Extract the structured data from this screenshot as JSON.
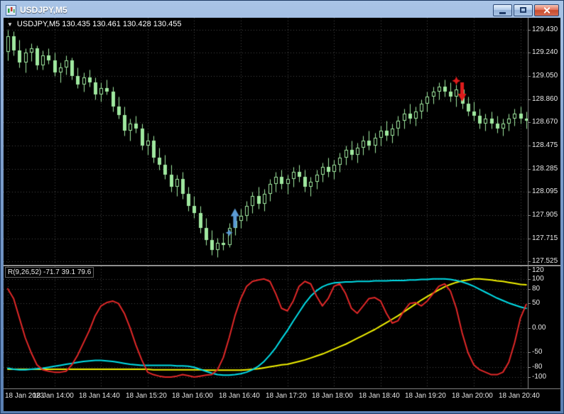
{
  "window": {
    "title": "USDJPY,M5"
  },
  "theme": {
    "background": "#000000",
    "grid": "#4a4a4a",
    "candle": "#9fe89f",
    "axis_text": "#e8e8e8",
    "axis_line": "#7f7f7f"
  },
  "chart": {
    "marker_icon": "▼",
    "ohlc_label": "USDJPY,M5 130.435 130.461 130.428 130.455"
  },
  "indicator": {
    "label": "R(9,26,52) -71.7 39.1 79.6"
  },
  "chart_data": {
    "type": "candlestick-with-oscillator",
    "symbol": "USDJPY",
    "timeframe": "M5",
    "layout": {
      "x0": 4,
      "dx": 8.2,
      "body_width": 5
    },
    "main": {
      "scale_max": 129.529,
      "scale_min": 127.496,
      "axis_labels": [
        "129.430",
        "129.240",
        "129.050",
        "128.860",
        "128.670",
        "128.475",
        "128.285",
        "128.095",
        "127.905",
        "127.715",
        "127.525"
      ],
      "candles": [
        [
          129.25,
          129.43,
          129.18,
          129.38
        ],
        [
          129.38,
          129.42,
          129.22,
          129.26
        ],
        [
          129.26,
          129.35,
          129.12,
          129.16
        ],
        [
          129.16,
          129.28,
          129.08,
          129.24
        ],
        [
          129.24,
          129.32,
          129.17,
          129.28
        ],
        [
          129.28,
          129.3,
          129.1,
          129.14
        ],
        [
          129.14,
          129.26,
          129.1,
          129.22
        ],
        [
          129.22,
          129.28,
          129.15,
          129.18
        ],
        [
          129.18,
          129.24,
          129.05,
          129.08
        ],
        [
          129.08,
          129.16,
          129.0,
          129.12
        ],
        [
          129.12,
          129.22,
          129.06,
          129.18
        ],
        [
          129.18,
          129.2,
          129.02,
          129.05
        ],
        [
          129.05,
          129.12,
          128.95,
          128.98
        ],
        [
          128.98,
          129.08,
          128.92,
          129.04
        ],
        [
          129.04,
          129.1,
          128.96,
          129.0
        ],
        [
          129.0,
          129.04,
          128.86,
          128.9
        ],
        [
          128.9,
          129.0,
          128.84,
          128.95
        ],
        [
          128.95,
          129.02,
          128.9,
          128.92
        ],
        [
          128.92,
          128.96,
          128.76,
          128.8
        ],
        [
          128.8,
          128.88,
          128.7,
          128.73
        ],
        [
          128.73,
          128.8,
          128.56,
          128.6
        ],
        [
          128.6,
          128.7,
          128.52,
          128.66
        ],
        [
          128.66,
          128.72,
          128.58,
          128.62
        ],
        [
          128.62,
          128.66,
          128.44,
          128.48
        ],
        [
          128.48,
          128.58,
          128.4,
          128.52
        ],
        [
          128.52,
          128.56,
          128.34,
          128.38
        ],
        [
          128.38,
          128.46,
          128.28,
          128.32
        ],
        [
          128.32,
          128.4,
          128.2,
          128.24
        ],
        [
          128.24,
          128.32,
          128.1,
          128.14
        ],
        [
          128.14,
          128.24,
          128.06,
          128.2
        ],
        [
          128.2,
          128.26,
          128.04,
          128.08
        ],
        [
          128.08,
          128.14,
          127.94,
          127.98
        ],
        [
          127.98,
          128.06,
          127.88,
          127.92
        ],
        [
          127.92,
          127.98,
          127.76,
          127.8
        ],
        [
          127.8,
          127.88,
          127.66,
          127.7
        ],
        [
          127.7,
          127.78,
          127.58,
          127.62
        ],
        [
          127.62,
          127.72,
          127.56,
          127.68
        ],
        [
          127.68,
          127.76,
          127.62,
          127.66
        ],
        [
          127.66,
          127.84,
          127.64,
          127.8
        ],
        [
          127.8,
          127.9,
          127.74,
          127.86
        ],
        [
          127.86,
          127.96,
          127.8,
          127.9
        ],
        [
          127.9,
          128.02,
          127.86,
          127.98
        ],
        [
          127.98,
          128.1,
          127.92,
          128.06
        ],
        [
          128.06,
          128.14,
          127.96,
          128.0
        ],
        [
          128.0,
          128.12,
          127.94,
          128.08
        ],
        [
          128.08,
          128.2,
          128.02,
          128.16
        ],
        [
          128.16,
          128.26,
          128.1,
          128.22
        ],
        [
          128.22,
          128.28,
          128.12,
          128.16
        ],
        [
          128.16,
          128.24,
          128.08,
          128.2
        ],
        [
          128.2,
          128.3,
          128.14,
          128.26
        ],
        [
          128.26,
          128.32,
          128.18,
          128.22
        ],
        [
          128.22,
          128.28,
          128.1,
          128.14
        ],
        [
          128.14,
          128.22,
          128.06,
          128.18
        ],
        [
          128.18,
          128.28,
          128.12,
          128.24
        ],
        [
          128.24,
          128.34,
          128.18,
          128.3
        ],
        [
          128.3,
          128.38,
          128.22,
          128.26
        ],
        [
          128.26,
          128.36,
          128.2,
          128.32
        ],
        [
          128.32,
          128.42,
          128.26,
          128.38
        ],
        [
          128.38,
          128.48,
          128.32,
          128.44
        ],
        [
          128.44,
          128.52,
          128.36,
          128.4
        ],
        [
          128.4,
          128.5,
          128.34,
          128.46
        ],
        [
          128.46,
          128.56,
          128.4,
          128.52
        ],
        [
          128.52,
          128.6,
          128.44,
          128.48
        ],
        [
          128.48,
          128.58,
          128.42,
          128.54
        ],
        [
          128.54,
          128.64,
          128.48,
          128.6
        ],
        [
          128.6,
          128.68,
          128.52,
          128.56
        ],
        [
          128.56,
          128.66,
          128.5,
          128.62
        ],
        [
          128.62,
          128.72,
          128.56,
          128.68
        ],
        [
          128.68,
          128.78,
          128.62,
          128.74
        ],
        [
          128.74,
          128.82,
          128.66,
          128.7
        ],
        [
          128.7,
          128.8,
          128.64,
          128.76
        ],
        [
          128.76,
          128.86,
          128.7,
          128.82
        ],
        [
          128.82,
          128.92,
          128.76,
          128.88
        ],
        [
          128.88,
          128.96,
          128.82,
          128.92
        ],
        [
          128.92,
          129.0,
          128.86,
          128.96
        ],
        [
          128.96,
          129.02,
          128.88,
          128.92
        ],
        [
          128.92,
          129.0,
          128.84,
          128.88
        ],
        [
          128.88,
          128.98,
          128.8,
          128.94
        ],
        [
          128.94,
          128.98,
          128.78,
          128.82
        ],
        [
          128.82,
          128.88,
          128.72,
          128.76
        ],
        [
          128.76,
          128.84,
          128.68,
          128.72
        ],
        [
          128.72,
          128.78,
          128.62,
          128.66
        ],
        [
          128.66,
          128.74,
          128.6,
          128.7
        ],
        [
          128.7,
          128.76,
          128.62,
          128.66
        ],
        [
          128.66,
          128.72,
          128.58,
          128.62
        ],
        [
          128.62,
          128.7,
          128.56,
          128.66
        ],
        [
          128.66,
          128.74,
          128.6,
          128.7
        ],
        [
          128.7,
          128.78,
          128.64,
          128.74
        ],
        [
          128.74,
          128.8,
          128.66,
          128.7
        ],
        [
          128.7,
          128.76,
          128.62,
          128.68
        ]
      ]
    },
    "oscillator": {
      "name": "R(9,26,52)",
      "current_values": [
        "-71.7",
        "39.1",
        "79.6"
      ],
      "scale_max": 125.8,
      "scale_min": -123.1,
      "axis_labels": [
        "120",
        "100",
        "80",
        "50",
        "0.00",
        "-50",
        "-80",
        "-100"
      ],
      "levels": [
        100,
        80,
        50,
        0,
        -50,
        -80,
        -100
      ],
      "series": [
        {
          "name": "fast-line",
          "color": "#e02828",
          "values": [
            80,
            60,
            20,
            -20,
            -50,
            -75,
            -85,
            -88,
            -90,
            -90,
            -88,
            -75,
            -55,
            -30,
            -5,
            25,
            45,
            52,
            55,
            50,
            30,
            0,
            -35,
            -65,
            -90,
            -95,
            -98,
            -100,
            -100,
            -98,
            -95,
            -97,
            -100,
            -98,
            -96,
            -95,
            -85,
            -60,
            -20,
            25,
            60,
            85,
            95,
            98,
            100,
            95,
            70,
            40,
            35,
            55,
            85,
            95,
            90,
            65,
            45,
            60,
            85,
            90,
            70,
            40,
            30,
            45,
            60,
            62,
            55,
            30,
            10,
            15,
            35,
            50,
            52,
            45,
            55,
            70,
            85,
            90,
            75,
            40,
            -10,
            -50,
            -75,
            -85,
            -90,
            -95,
            -95,
            -90,
            -70,
            -30,
            20,
            48
          ]
        },
        {
          "name": "medium-line",
          "color": "#00dce6",
          "values": [
            -82,
            -84,
            -85,
            -85,
            -84,
            -83,
            -82,
            -80,
            -78,
            -76,
            -74,
            -72,
            -70,
            -68,
            -67,
            -66,
            -66,
            -67,
            -68,
            -70,
            -72,
            -74,
            -75,
            -76,
            -76,
            -76,
            -76,
            -76,
            -76,
            -77,
            -77,
            -78,
            -80,
            -84,
            -88,
            -92,
            -95,
            -96,
            -96,
            -95,
            -93,
            -90,
            -85,
            -78,
            -68,
            -55,
            -40,
            -22,
            -5,
            14,
            32,
            50,
            65,
            76,
            84,
            89,
            92,
            93,
            94,
            94,
            95,
            95,
            95,
            96,
            96,
            96,
            97,
            97,
            97,
            98,
            98,
            99,
            99,
            100,
            100,
            100,
            99,
            97,
            94,
            90,
            85,
            79,
            73,
            67,
            61,
            56,
            51,
            47,
            43,
            40
          ]
        },
        {
          "name": "slow-line",
          "color": "#f0f000",
          "values": [
            -84,
            -84,
            -84,
            -84,
            -84,
            -84,
            -84,
            -84,
            -84,
            -84,
            -84,
            -84,
            -84,
            -84,
            -84,
            -84,
            -84,
            -84,
            -84,
            -84,
            -84,
            -84,
            -84,
            -84,
            -84,
            -85,
            -85,
            -85,
            -85,
            -85,
            -85,
            -85,
            -85,
            -85,
            -86,
            -86,
            -86,
            -86,
            -86,
            -86,
            -86,
            -85,
            -84,
            -83,
            -81,
            -79,
            -77,
            -75,
            -74,
            -71,
            -68,
            -65,
            -61,
            -57,
            -53,
            -48,
            -43,
            -38,
            -33,
            -27,
            -21,
            -15,
            -9,
            -3,
            4,
            11,
            18,
            25,
            33,
            41,
            49,
            57,
            64,
            71,
            78,
            84,
            89,
            93,
            96,
            98,
            100,
            100,
            99,
            98,
            96,
            95,
            93,
            91,
            89,
            88
          ]
        }
      ]
    },
    "time_axis": [
      {
        "text": "18 Jan 2023",
        "index": 0
      },
      {
        "text": "18 Jan 14:00",
        "index": 8
      },
      {
        "text": "18 Jan 14:40",
        "index": 16
      },
      {
        "text": "18 Jan 15:20",
        "index": 24
      },
      {
        "text": "18 Jan 16:00",
        "index": 32
      },
      {
        "text": "18 Jan 16:40",
        "index": 40
      },
      {
        "text": "18 Jan 17:20",
        "index": 48
      },
      {
        "text": "18 Jan 18:00",
        "index": 56
      },
      {
        "text": "18 Jan 18:40",
        "index": 64
      },
      {
        "text": "18 Jan 19:20",
        "index": 72
      },
      {
        "text": "18 Jan 20:00",
        "index": 80
      },
      {
        "text": "18 Jan 20:40",
        "index": 88
      }
    ],
    "signals": [
      {
        "name": "buy-arrow",
        "shape": "arrow-up",
        "index": 39,
        "price": 127.96,
        "color": "#5b9bd5",
        "size": 28
      },
      {
        "name": "buy-star",
        "shape": "star",
        "index": 38,
        "price": 127.76,
        "color": "#5b9bd5",
        "size": 5
      },
      {
        "name": "sell-arrow",
        "shape": "arrow-down",
        "index": 78,
        "price": 128.84,
        "color": "#dd1c1c",
        "size": 28
      },
      {
        "name": "sell-star",
        "shape": "star",
        "index": 77,
        "price": 129.01,
        "color": "#dd1c1c",
        "size": 6
      }
    ]
  }
}
